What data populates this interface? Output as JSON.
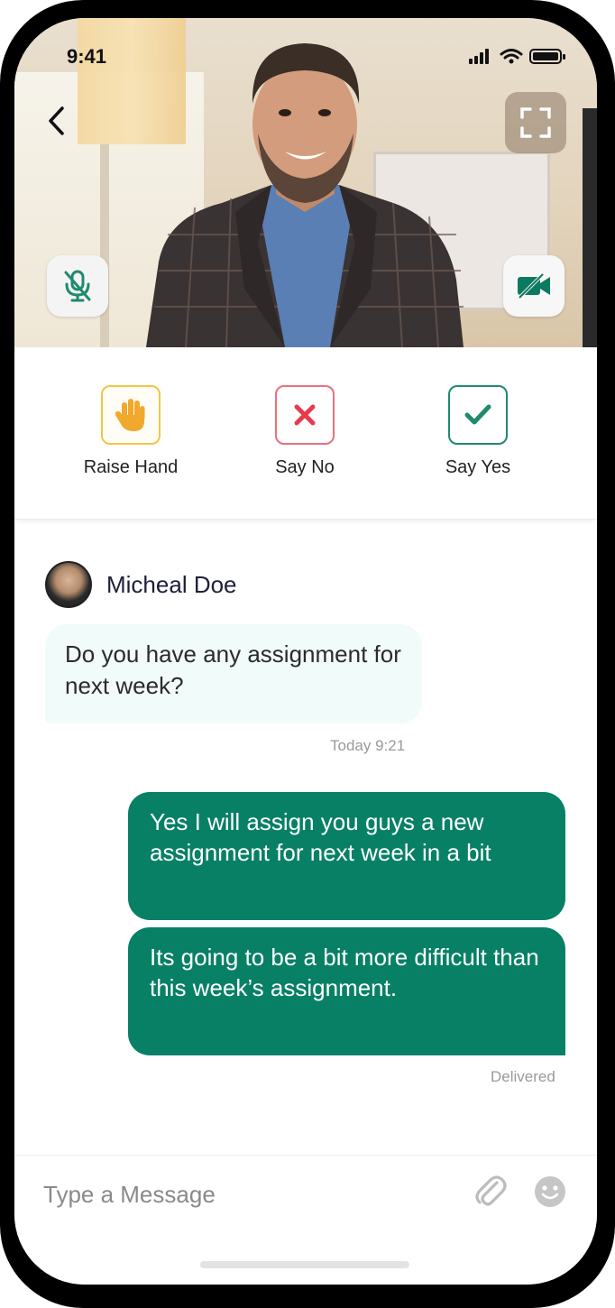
{
  "status_bar": {
    "time": "9:41"
  },
  "video": {
    "buttons": {
      "back_icon": "chevron-left-icon",
      "fullscreen_icon": "fullscreen-icon",
      "mic_icon": "mic-off-icon",
      "camera_icon": "video-off-icon"
    }
  },
  "reactions": [
    {
      "label": "Raise Hand",
      "icon": "hand-icon",
      "color": "#f3c547"
    },
    {
      "label": "Say No",
      "icon": "close-icon",
      "color": "#e9707d"
    },
    {
      "label": "Say Yes",
      "icon": "check-icon",
      "color": "#1f8a6e"
    }
  ],
  "chat": {
    "sender_name": "Micheal Doe",
    "incoming": {
      "text": "Do you have any assignment for next week?",
      "time": "Today 9:21"
    },
    "outgoing": [
      {
        "text": "Yes I will assign you guys a new assignment for next week in a bit"
      },
      {
        "text": "Its going to be a bit more difficult than this week’s assignment."
      }
    ],
    "status": "Delivered"
  },
  "composer": {
    "placeholder": "Type a Message",
    "value": "",
    "attach_icon": "paperclip-icon",
    "emoji_icon": "smiley-icon"
  },
  "colors": {
    "accent": "#078066",
    "incoming_bubble": "#f1fbfa",
    "hand": "#f3c547",
    "no": "#e9707d",
    "yes": "#1f8a6e"
  }
}
